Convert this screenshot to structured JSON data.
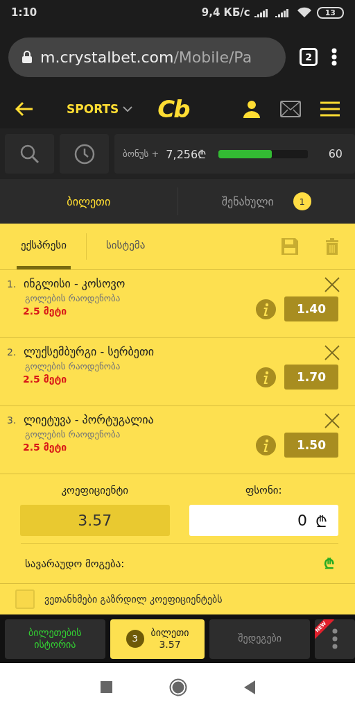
{
  "status_bar": {
    "time": "1:10",
    "speed": "9,4 КБ/с",
    "battery": "13"
  },
  "browser": {
    "url_host": "m.crystalbet.com",
    "url_path": "/Mobile/Pa",
    "tab_count": "2"
  },
  "header": {
    "section": "SPORTS",
    "logo": "Cb"
  },
  "bonus": {
    "label": "ბონუს +",
    "amount": "7,256₾",
    "level": 0.6,
    "target": "60"
  },
  "main_tabs": [
    {
      "label": "ბილეთი",
      "selected": true
    },
    {
      "label": "შენახული",
      "selected": false,
      "badge": "1"
    }
  ],
  "bet_tabs": [
    {
      "label": "ექსპრესი",
      "selected": true
    },
    {
      "label": "სისტემა",
      "selected": false
    }
  ],
  "bets": [
    {
      "number": "1.",
      "match": "ინგლისი - კოსოვო",
      "market": "გოლების რაოდენობა",
      "pick": "2.5 მეტი",
      "odds": "1.40"
    },
    {
      "number": "2.",
      "match": "ლუქსემბურგი - სერბეთი",
      "market": "გოლების რაოდენობა",
      "pick": "2.5 მეტი",
      "odds": "1.70"
    },
    {
      "number": "3.",
      "match": "ლიეტუვა - პორტუგალია",
      "market": "გოლების რაოდენობა",
      "pick": "2.5 მეტი",
      "odds": "1.50"
    }
  ],
  "summary": {
    "odds_label": "კოეფიციენტი",
    "odds": "3.57",
    "stake_label": "ფსონი:",
    "stake": "0",
    "currency": "₾",
    "win_label": "სავარაუდო მოგება:",
    "win_currency": "₾"
  },
  "accept_checkbox": {
    "label": "ვეთანხმები გაზრდილ კოეფიციენტებს",
    "checked": false
  },
  "bottom_nav": [
    {
      "kind": "text",
      "label": "ბილეთების ისტორია",
      "selected": false,
      "color": "#33cc33"
    },
    {
      "kind": "slip",
      "count": "3",
      "label": "ბილეთი",
      "odds": "3.57",
      "selected": true
    },
    {
      "kind": "text",
      "label": "შედეგები",
      "selected": false,
      "color": "#8a8a8a"
    },
    {
      "kind": "more",
      "badge": "NEW",
      "selected": false
    }
  ]
}
